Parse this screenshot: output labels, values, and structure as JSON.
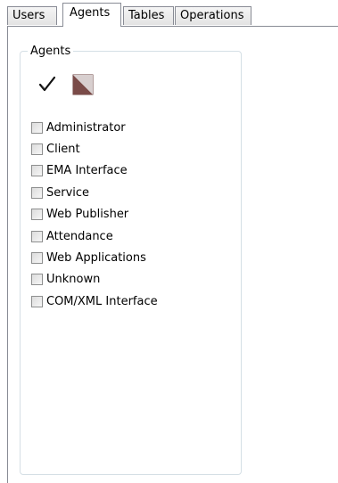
{
  "tabs": [
    {
      "label": "Users"
    },
    {
      "label": "Agents",
      "active": true
    },
    {
      "label": "Tables"
    },
    {
      "label": "Operations"
    }
  ],
  "group": {
    "title": "Agents",
    "toolbar": [
      {
        "icon": "checkmark-icon",
        "action": "select-all"
      },
      {
        "icon": "half-filled-square-icon",
        "action": "invert-selection"
      }
    ],
    "items": [
      {
        "label": "Administrator",
        "checked": false
      },
      {
        "label": "Client",
        "checked": false
      },
      {
        "label": "EMA Interface",
        "checked": false
      },
      {
        "label": "Service",
        "checked": false
      },
      {
        "label": "Web Publisher",
        "checked": false
      },
      {
        "label": "Attendance",
        "checked": false
      },
      {
        "label": "Web Applications",
        "checked": false
      },
      {
        "label": "Unknown",
        "checked": false
      },
      {
        "label": "COM/XML Interface",
        "checked": false
      }
    ]
  },
  "colors": {
    "tab_border": "#898c95",
    "group_border": "#d5dfe5",
    "icon_fill": "#7a4b48"
  }
}
